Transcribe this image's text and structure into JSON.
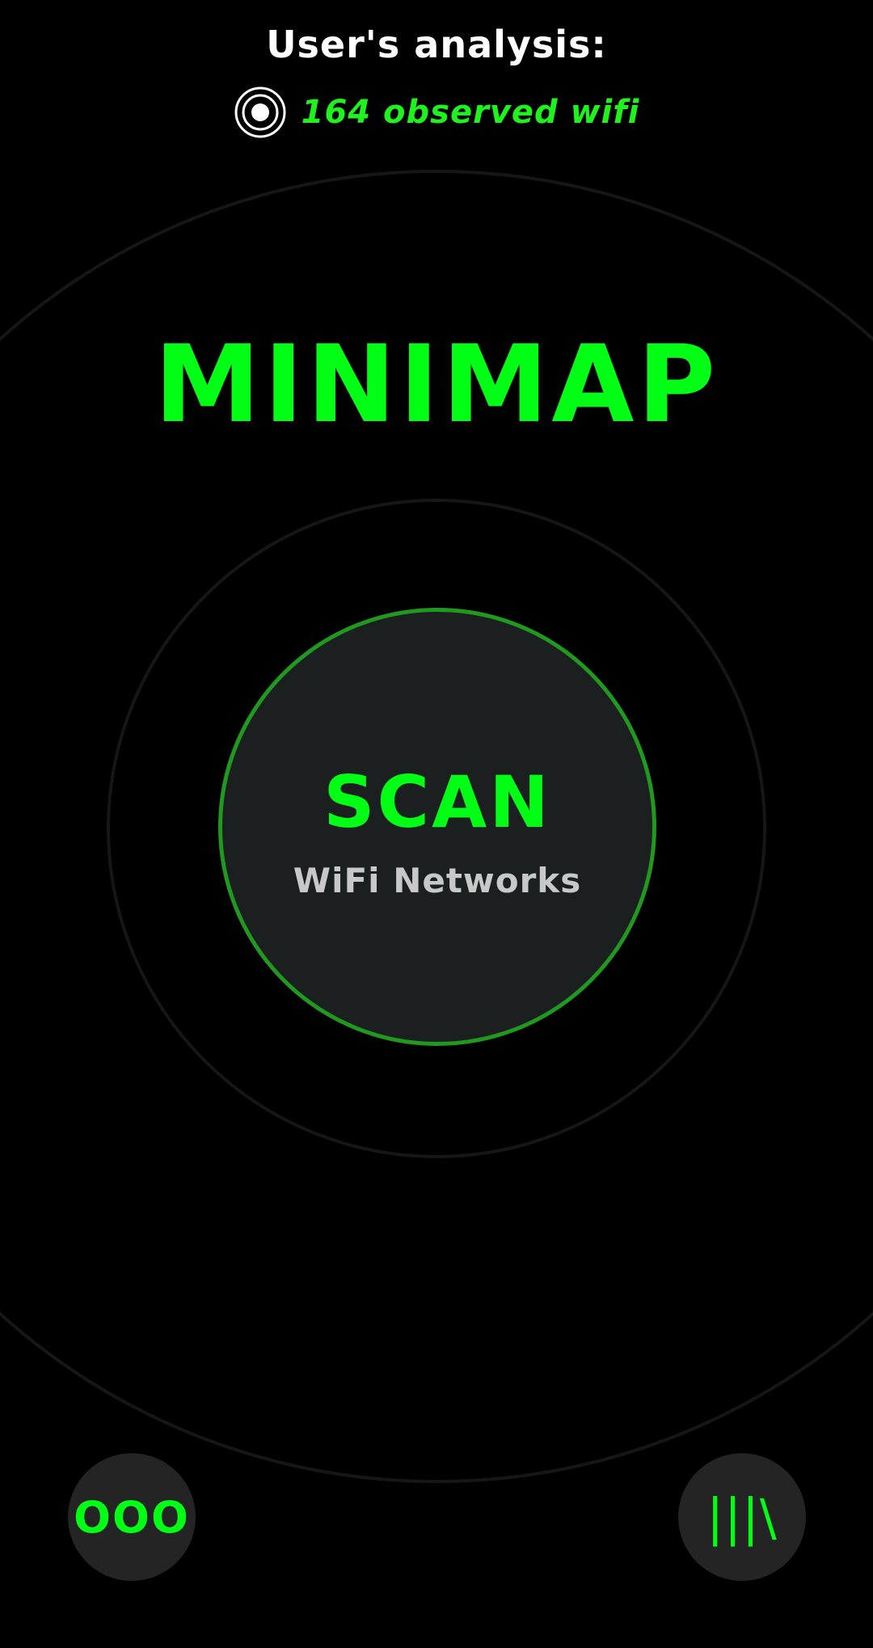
{
  "header": {
    "title": "User's analysis:",
    "wifi_count_text": "164 observed wifi",
    "icon": "target-icon"
  },
  "main": {
    "title": "MINIMAP"
  },
  "scan_button": {
    "label": "SCAN",
    "sublabel": "WiFi Networks"
  },
  "footer": {
    "left_button": {
      "label": "OOO",
      "icon": "more-options-icon"
    },
    "right_button": {
      "label": "|||\\",
      "icon": "library-icon"
    }
  },
  "colors": {
    "background": "#000000",
    "accent_green": "#00ff14",
    "ring_green": "#1f9a1f",
    "button_bg": "#242424",
    "scan_bg": "#1b1f1f",
    "subtext": "#c8c8c8"
  }
}
